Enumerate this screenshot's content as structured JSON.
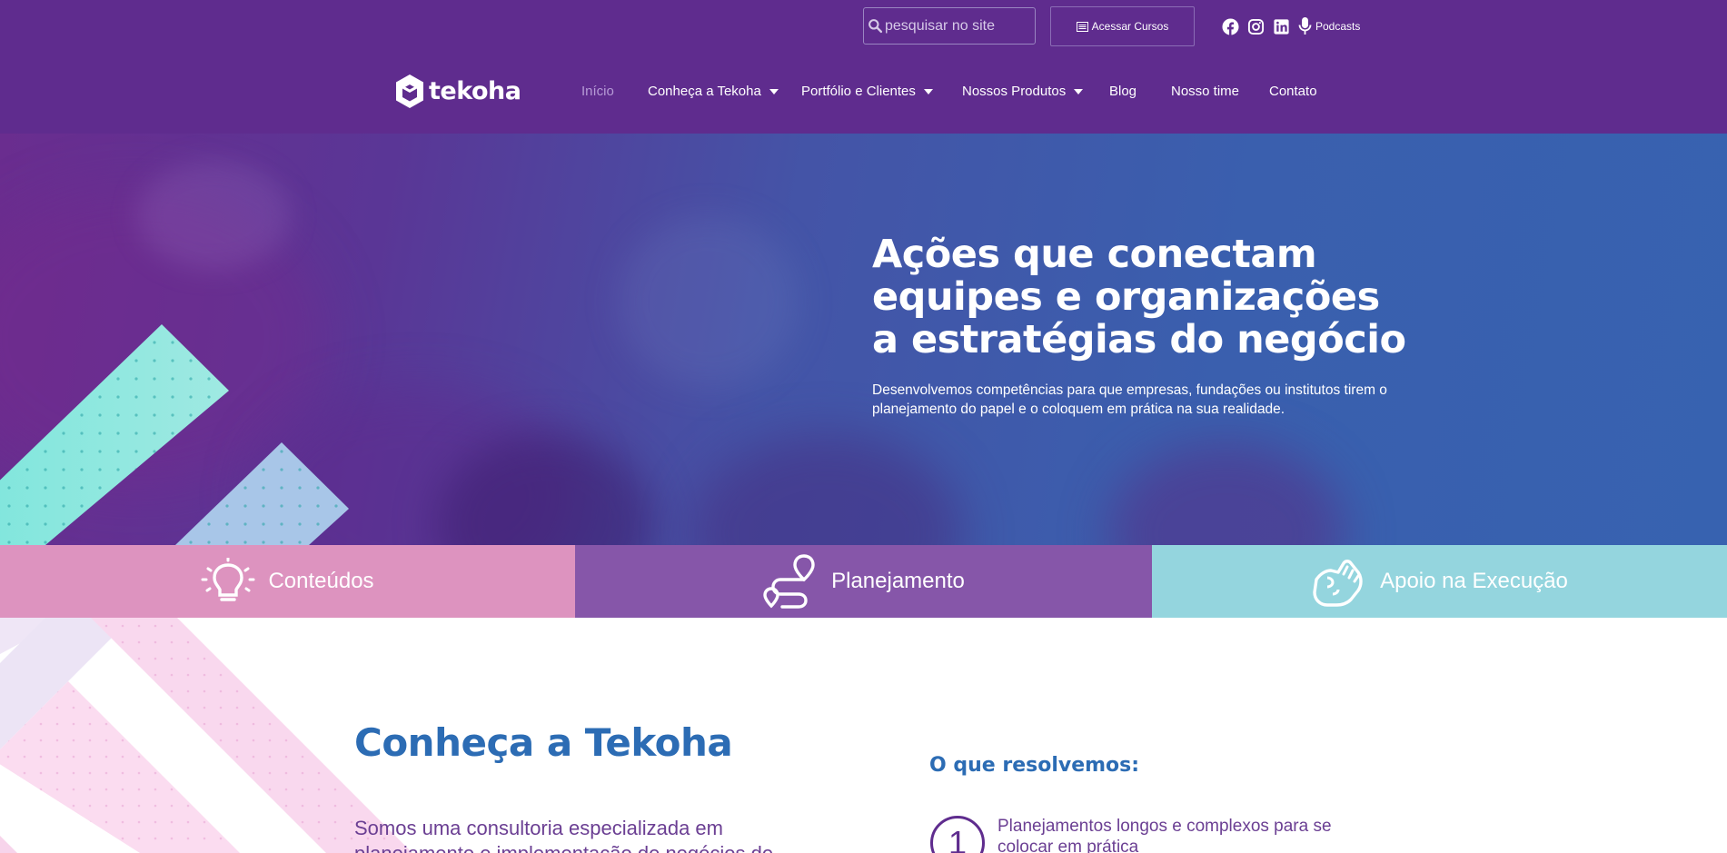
{
  "header": {
    "search": {
      "placeholder": "pesquisar no site",
      "value": ""
    },
    "courses_label": "Acessar Cursos",
    "podcast_label": "Podcasts",
    "social": [
      "facebook-icon",
      "instagram-icon",
      "linkedin-icon",
      "microphone-icon"
    ],
    "logo_text": "tekoha",
    "nav": [
      {
        "label": "Início",
        "active": true,
        "dropdown": false
      },
      {
        "label": "Conheça a Tekoha",
        "active": false,
        "dropdown": true
      },
      {
        "label": "Portfólio e Clientes",
        "active": false,
        "dropdown": true
      },
      {
        "label": "Nossos Produtos",
        "active": false,
        "dropdown": true
      },
      {
        "label": "Blog",
        "active": false,
        "dropdown": false
      },
      {
        "label": "Nosso time",
        "active": false,
        "dropdown": false
      },
      {
        "label": "Contato",
        "active": false,
        "dropdown": false
      }
    ]
  },
  "hero": {
    "title": "Ações que conectam equipes e organizações a estratégias do negócio",
    "subtitle": "Desenvolvemos competências para que empresas, fundações ou institutos tirem o planejamento do papel e o coloquem em prática na sua realidade."
  },
  "strip": [
    {
      "label": "Conteúdos",
      "icon": "lightbulb-icon",
      "color": "#dd93bf"
    },
    {
      "label": "Planejamento",
      "icon": "route-icon",
      "color": "#8656a9"
    },
    {
      "label": "Apoio na Execução",
      "icon": "handshake-icon",
      "color": "#94d5de"
    }
  ],
  "about": {
    "title": "Conheça a Tekoha",
    "text": "Somos uma consultoria especializada em planejamento e implementação de negócios de"
  },
  "solve": {
    "title": "O que resolvemos:",
    "items": [
      {
        "number": "1",
        "text": "Planejamentos longos e complexos para se colocar em prática"
      }
    ]
  },
  "colors": {
    "header_bg": "#5f2c8e",
    "accent_blue": "#2c6cb4",
    "text_purple": "#6b3f93",
    "teal": "#7ee6dc"
  }
}
